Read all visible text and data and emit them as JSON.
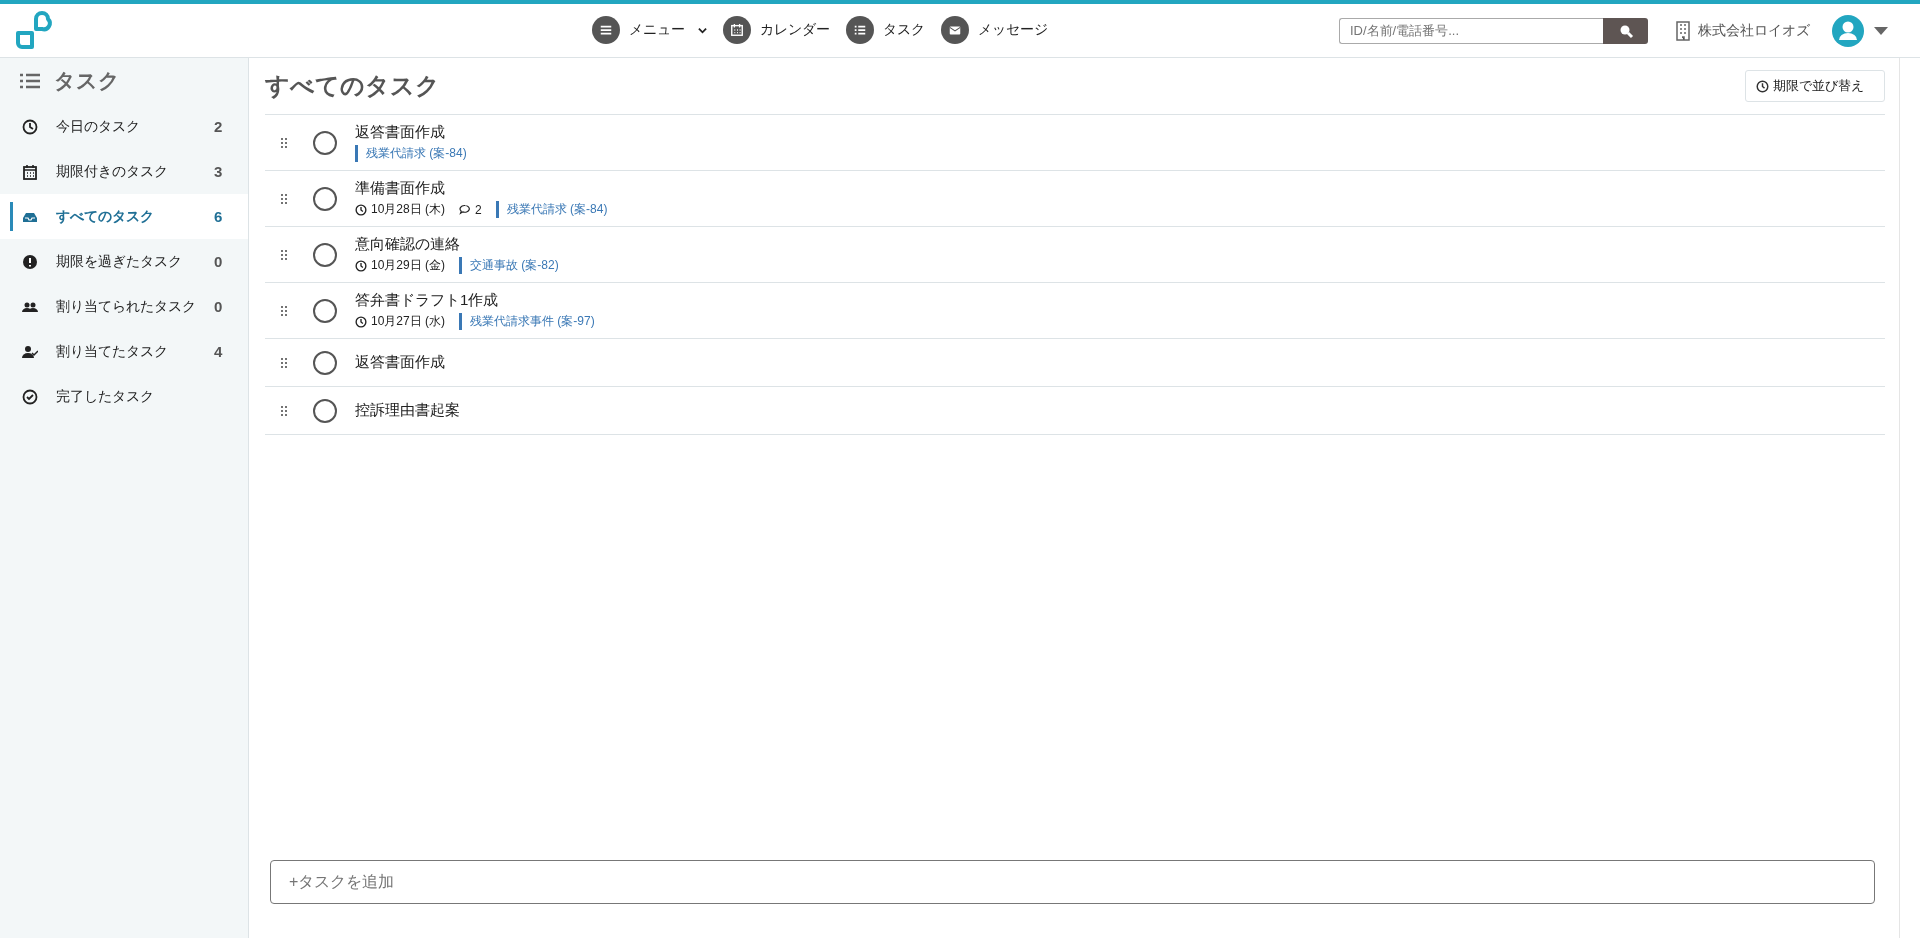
{
  "header": {
    "nav": [
      {
        "label": "メニュー",
        "dropdown": true
      },
      {
        "label": "カレンダー",
        "dropdown": false
      },
      {
        "label": "タスク",
        "dropdown": false
      },
      {
        "label": "メッセージ",
        "dropdown": false
      }
    ],
    "search": {
      "placeholder": "ID/名前/電話番号..."
    },
    "company": "株式会社ロイオズ"
  },
  "sidebar": {
    "title": "タスク",
    "items": [
      {
        "label": "今日のタスク",
        "count": "2",
        "selected": false
      },
      {
        "label": "期限付きのタスク",
        "count": "3",
        "selected": false
      },
      {
        "label": "すべてのタスク",
        "count": "6",
        "selected": true
      },
      {
        "label": "期限を過ぎたタスク",
        "count": "0",
        "selected": false
      },
      {
        "label": "割り当てられたタスク",
        "count": "0",
        "selected": false
      },
      {
        "label": "割り当てたタスク",
        "count": "4",
        "selected": false
      },
      {
        "label": "完了したタスク",
        "selected": false
      }
    ]
  },
  "main": {
    "title": "すべてのタスク",
    "sort_button": "期限で並び替え",
    "tasks": [
      {
        "title": "返答書面作成",
        "done": false,
        "case": "残業代請求 (案-84)"
      },
      {
        "title": "準備書面作成",
        "done": false,
        "due": "10月28日 (木)",
        "comments": "2",
        "case": "残業代請求 (案-84)"
      },
      {
        "title": "意向確認の連絡",
        "done": false,
        "due": "10月29日 (金)",
        "case": "交通事故 (案-82)"
      },
      {
        "title": "答弁書ドラフト1作成",
        "done": false,
        "due": "10月27日 (水)",
        "case": "残業代請求事件 (案-97)"
      },
      {
        "title": "返答書面作成",
        "done": false
      },
      {
        "title": "控訴理由書起案",
        "done": false
      }
    ],
    "add_task": {
      "placeholder": "+タスクを追加"
    }
  }
}
